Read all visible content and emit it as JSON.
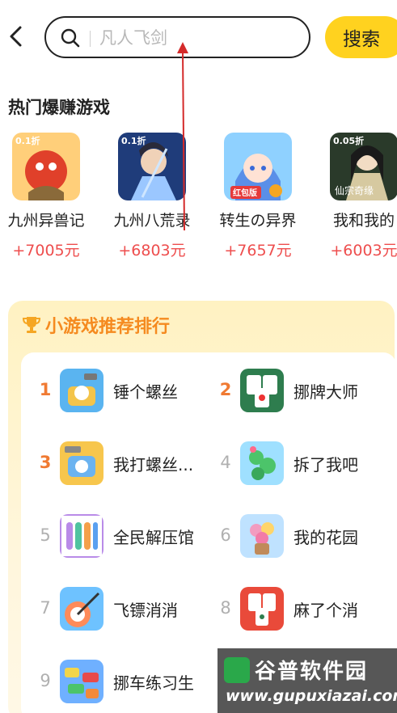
{
  "header": {
    "search_placeholder": "凡人飞剑",
    "search_button": "搜索"
  },
  "hot_games": {
    "title": "热门爆赚游戏",
    "items": [
      {
        "name": "九州异兽记",
        "reward": "+7005元",
        "badge": "0.1折",
        "colors": [
          "#ffcf7a",
          "#e0402a"
        ]
      },
      {
        "name": "九州八荒录",
        "reward": "+6803元",
        "badge": "0.1折",
        "colors": [
          "#1f3c7a",
          "#9bc7ff"
        ]
      },
      {
        "name": "转生の异界",
        "reward": "+7657元",
        "badge": "红包版",
        "colors": [
          "#8fd1ff",
          "#ff7fb8"
        ]
      },
      {
        "name": "我和我的",
        "reward": "+6003元",
        "badge": "0.05折",
        "colors": [
          "#2a3a2a",
          "#d6c9a0"
        ]
      }
    ]
  },
  "ranking": {
    "title": "小游戏推荐排行",
    "items": [
      {
        "rank": "1",
        "name": "锤个螺丝",
        "colors": [
          "#5ab4f0",
          "#f3c44a"
        ]
      },
      {
        "rank": "2",
        "name": "挪牌大师",
        "colors": [
          "#2e7d4e",
          "#ffffff"
        ]
      },
      {
        "rank": "3",
        "name": "我打螺丝...",
        "colors": [
          "#f7c64d",
          "#6bb3f0"
        ]
      },
      {
        "rank": "4",
        "name": "拆了我吧",
        "colors": [
          "#9fe0ff",
          "#4cc46a"
        ]
      },
      {
        "rank": "5",
        "name": "全民解压馆",
        "colors": [
          "#b98be8",
          "#4fc3a0"
        ]
      },
      {
        "rank": "6",
        "name": "我的花园",
        "colors": [
          "#bfe2ff",
          "#f29cc0"
        ]
      },
      {
        "rank": "7",
        "name": "飞镖消消",
        "colors": [
          "#ff8b5a",
          "#6ec2ff"
        ]
      },
      {
        "rank": "8",
        "name": "麻了个消",
        "colors": [
          "#e94a3a",
          "#ffffff"
        ]
      },
      {
        "rank": "9",
        "name": "挪车练习生",
        "colors": [
          "#6fb0ff",
          "#f2d54a"
        ]
      }
    ]
  },
  "watermark": {
    "line1": "谷普软件园",
    "line2": "www.gupuxiazai.com"
  },
  "colors": {
    "accent_yellow": "#ffd21f",
    "reward_red": "#ee4e4e",
    "rank_orange": "#f07a32",
    "annotation_red": "#d42a2a"
  }
}
